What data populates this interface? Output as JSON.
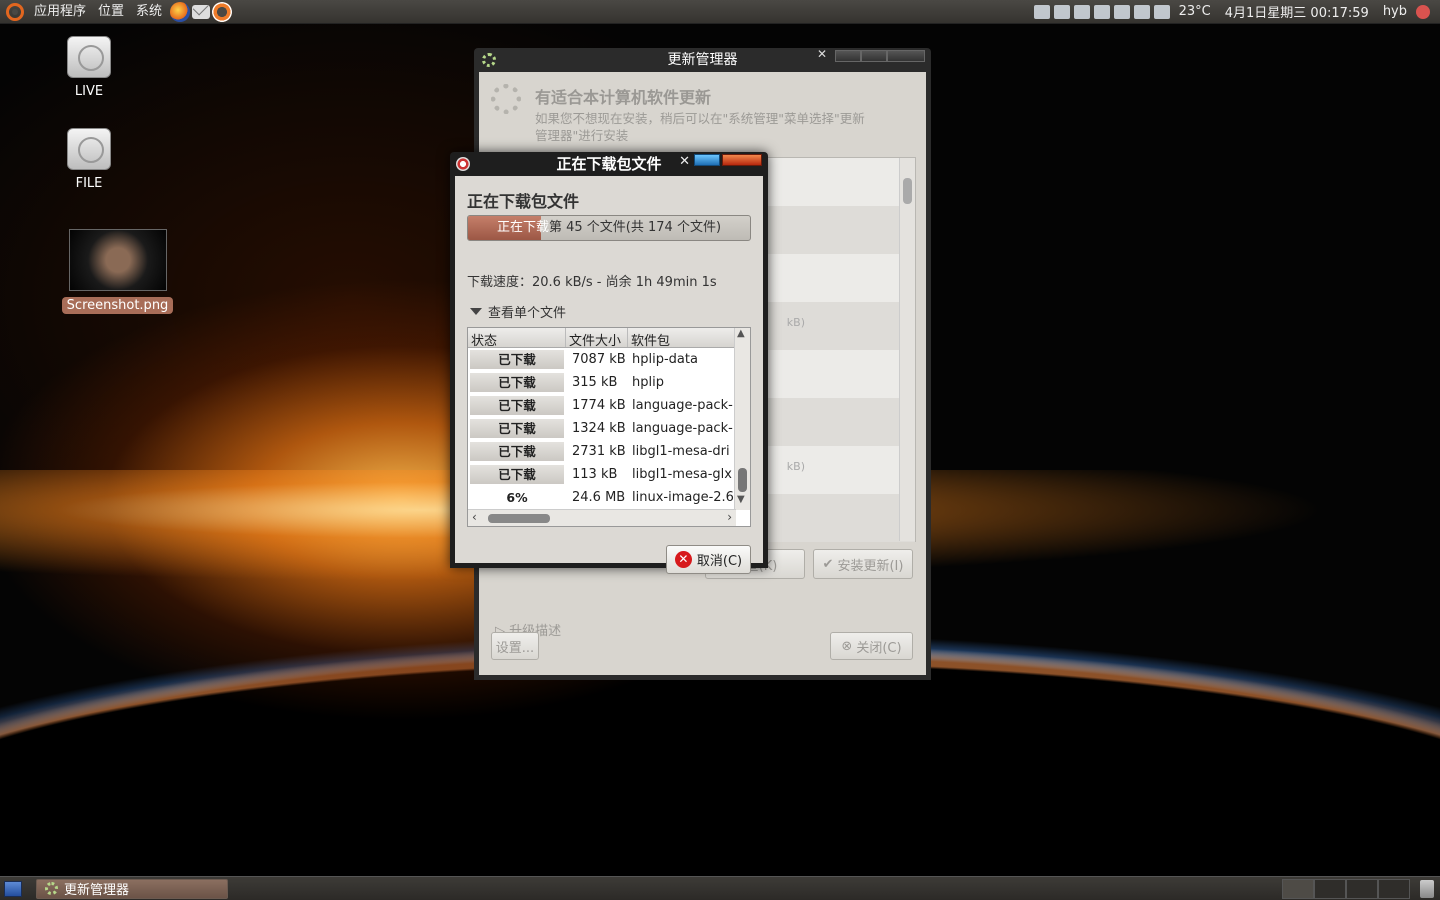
{
  "top_panel": {
    "menus": [
      "应用程序",
      "位置",
      "系统"
    ],
    "weather": "23°C",
    "clock": "4月1日星期三 00:17:59",
    "user": "hyb"
  },
  "desktop_icons": [
    {
      "label": "LIVE"
    },
    {
      "label": "FILE"
    },
    {
      "label": "Screenshot.png"
    }
  ],
  "update_manager": {
    "title": "更新管理器",
    "heading": "有适合本计算机软件更新",
    "description": "如果您不想现在安装，稍后可以在\"系统管理\"菜单选择\"更新管理器\"进行安装",
    "list_size_1": "kB)",
    "list_size_2": "kB)",
    "check_label": "检查(K)",
    "install_label": "安装更新(I)",
    "details_label": "升级描述",
    "settings_label": "设置...",
    "close_label": "关闭(C)"
  },
  "download_dialog": {
    "title": "正在下载包文件",
    "heading": "正在下载包文件",
    "progress_lead": "正在下载",
    "progress_rest": "第 45 个文件(共 174 个文件)",
    "progress_fraction": 0.26,
    "speed": "下载速度：20.6 kB/s - 尚余 1h 49min 1s",
    "details_label": "查看单个文件",
    "columns": [
      "状态",
      "文件大小",
      "软件包"
    ],
    "rows": [
      {
        "status": "已下载",
        "size": "7087 kB",
        "package": "hplip-data"
      },
      {
        "status": "已下载",
        "size": "315 kB",
        "package": "hplip"
      },
      {
        "status": "已下载",
        "size": "1774 kB",
        "package": "language-pack-"
      },
      {
        "status": "已下载",
        "size": "1324 kB",
        "package": "language-pack-"
      },
      {
        "status": "已下载",
        "size": "2731 kB",
        "package": "libgl1-mesa-dri"
      },
      {
        "status": "已下载",
        "size": "113 kB",
        "package": "libgl1-mesa-glx"
      },
      {
        "status": "6%",
        "size": "24.6 MB",
        "package": "linux-image-2.6"
      }
    ],
    "cancel_label": "取消(C)"
  },
  "taskbar": {
    "task_label": "更新管理器"
  }
}
